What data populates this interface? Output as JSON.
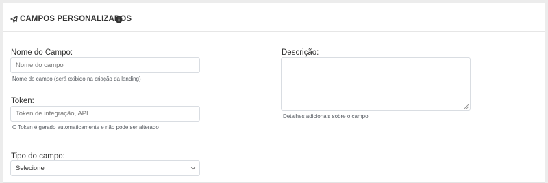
{
  "header": {
    "title": "CAMPOS PERSONALIZADOS",
    "title_icon": "paper-plane-icon",
    "info_icon": "info-circle-icon"
  },
  "form": {
    "field_name": {
      "label": "Nome do Campo:",
      "placeholder": "Nome do campo",
      "help": "Nome do campo (será exibido na criação da landing)"
    },
    "token": {
      "label": "Token:",
      "placeholder": "Token de integração, API",
      "help": "O Token é gerado automaticamente e não pode ser alterado"
    },
    "field_type": {
      "label": "Tipo do campo:",
      "selected": "Selecione",
      "icon": "chevron-down-icon"
    },
    "description": {
      "label": "Descrição:",
      "help": "Detalhes adicionais sobre o campo"
    }
  },
  "colors": {
    "header_text": "#333333",
    "border": "#d9dde2",
    "placeholder": "#b3b3b3",
    "help_text": "#555a60",
    "page_background": "#ececec"
  }
}
